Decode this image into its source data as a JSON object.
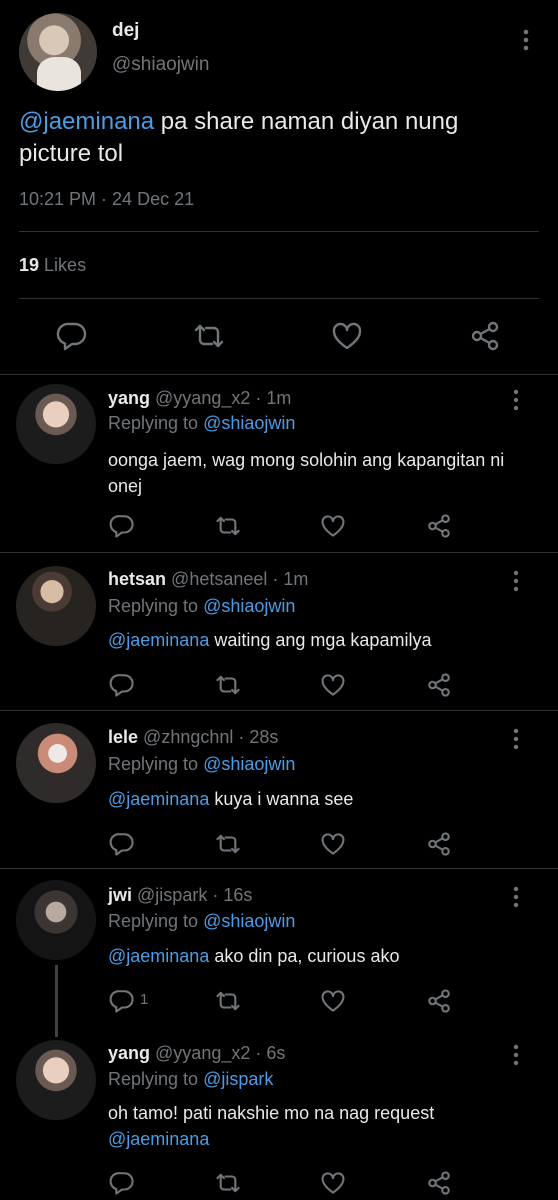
{
  "main_tweet": {
    "display_name": "dej",
    "handle": "@shiaojwin",
    "mention": "@jaeminana",
    "text": " pa share naman diyan nung picture tol",
    "timestamp": "10:21 PM · 24 Dec 21",
    "likes_count": "19",
    "likes_label": "Likes"
  },
  "replies": [
    {
      "display_name": "yang",
      "handle": "@yyang_x2",
      "time": " · 1m",
      "replying_prefix": "Replying to ",
      "replying_to": "@shiaojwin",
      "mention": "",
      "text": "oonga jaem, wag mong solohin ang kapangitan ni onej",
      "reply_count": ""
    },
    {
      "display_name": "hetsan",
      "handle": "@hetsaneel",
      "time": " · 1m",
      "replying_prefix": "Replying to ",
      "replying_to": "@shiaojwin",
      "mention": "@jaeminana",
      "text": " waiting ang mga kapamilya",
      "reply_count": ""
    },
    {
      "display_name": "lele",
      "handle": "@zhngchnl",
      "time": " · 28s",
      "replying_prefix": "Replying to ",
      "replying_to": "@shiaojwin",
      "mention": "@jaeminana",
      "text": " kuya i wanna see",
      "reply_count": ""
    },
    {
      "display_name": "jwi",
      "handle": "@jispark",
      "time": " · 16s",
      "replying_prefix": "Replying to ",
      "replying_to": "@shiaojwin",
      "mention": "@jaeminana",
      "text": " ako din pa, curious ako",
      "reply_count": "1"
    },
    {
      "display_name": "yang",
      "handle": "@yyang_x2",
      "time": " · 6s",
      "replying_prefix": "Replying to ",
      "replying_to": "@jispark",
      "mention": "",
      "text": "oh tamo! pati nakshie mo na nag request",
      "mention_after": "@jaeminana",
      "reply_count": ""
    }
  ],
  "icons": {
    "reply": "reply-icon",
    "retweet": "retweet-icon",
    "like": "heart-icon",
    "share": "share-icon",
    "more": "more-vertical-icon"
  },
  "colors": {
    "background": "#000000",
    "text": "#e7e9ea",
    "muted": "#71767b",
    "link": "#4a9de6",
    "divider": "#2f3336"
  }
}
